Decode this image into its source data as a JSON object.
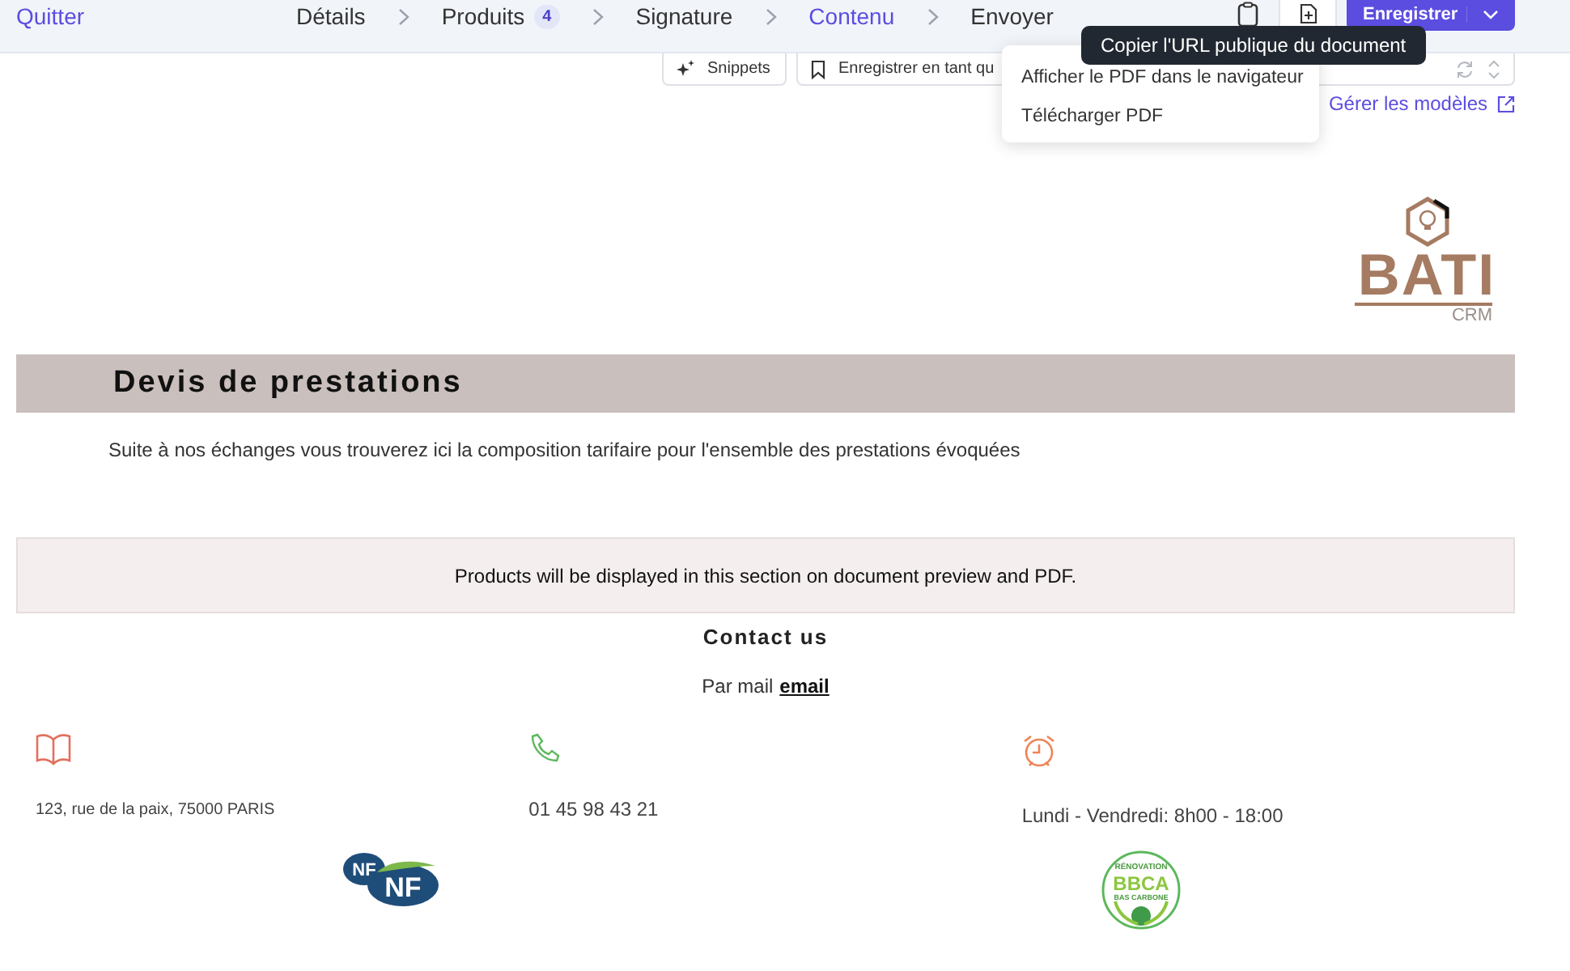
{
  "header": {
    "exit_link": "Quitter",
    "steps": [
      {
        "label": "Détails",
        "selected": false
      },
      {
        "label": "Produits",
        "badge": "4",
        "selected": false
      },
      {
        "label": "Signature",
        "selected": false
      },
      {
        "label": "Contenu",
        "selected": true
      },
      {
        "label": "Envoyer",
        "selected": false
      }
    ],
    "save_button": "Enregistrer"
  },
  "tooltip": "Copier l'URL publique du document",
  "menu": {
    "items": [
      "Afficher le PDF dans le navigateur",
      "Télécharger PDF"
    ]
  },
  "toolbar": {
    "snippets_button": "Snippets",
    "template_select": "Enregistrer en tant qu",
    "manage_link": "Gérer les modèles"
  },
  "document": {
    "logo": {
      "name": "BATI",
      "sub": "CRM"
    },
    "title": "Devis de prestations",
    "intro": "Suite à nos échanges vous trouverez ici la composition tarifaire pour l'ensemble des prestations évoquées",
    "products_notice": "Products will be displayed in this section on document preview and PDF.",
    "contact": {
      "title": "Contact us",
      "mail_label": "Par mail",
      "mail_link": "email",
      "columns": [
        {
          "kind": "address",
          "text": "123, rue de la paix, 75000 PARIS"
        },
        {
          "kind": "phone",
          "text": "01 45 98 43 21"
        },
        {
          "kind": "hours",
          "text": "Lundi - Vendredi: 8h00 - 18:00"
        }
      ]
    },
    "badges": [
      {
        "kind": "nf",
        "lines": [
          "NF",
          "NF"
        ]
      },
      {
        "kind": "bbca",
        "lines": [
          "RÉNOVATION",
          "BBCA",
          "BAS CARBONE"
        ]
      }
    ]
  }
}
